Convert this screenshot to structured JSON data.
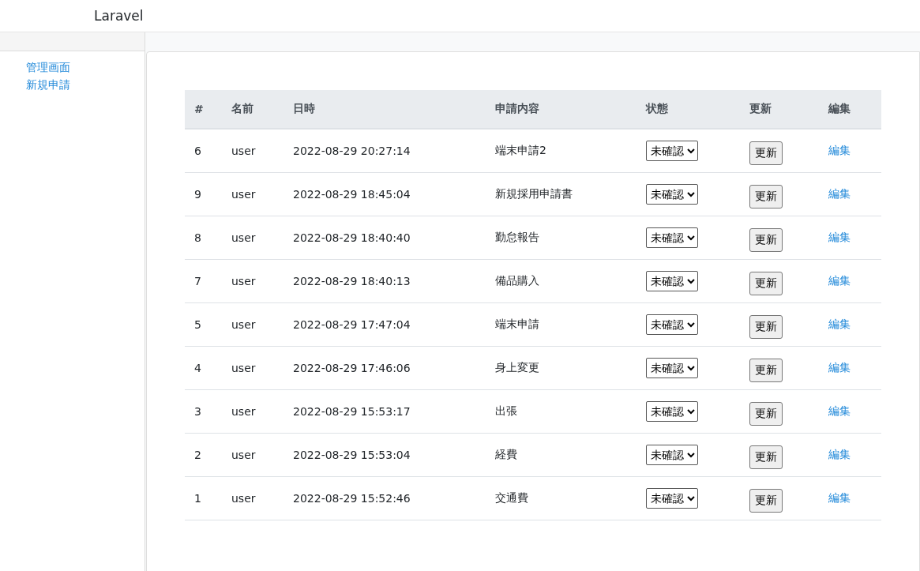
{
  "navbar": {
    "brand": "Laravel"
  },
  "sidebar": {
    "items": [
      {
        "label": "管理画面"
      },
      {
        "label": "新規申請"
      }
    ]
  },
  "table": {
    "columns": [
      "#",
      "名前",
      "日時",
      "申請内容",
      "状態",
      "更新",
      "編集"
    ],
    "rows": [
      {
        "id": "6",
        "name": "user",
        "datetime": "2022-08-29 20:27:14",
        "content": "端末申請2",
        "status": "未確認",
        "update": "更新",
        "edit": "編集"
      },
      {
        "id": "9",
        "name": "user",
        "datetime": "2022-08-29 18:45:04",
        "content": "新規採用申請書",
        "status": "未確認",
        "update": "更新",
        "edit": "編集"
      },
      {
        "id": "8",
        "name": "user",
        "datetime": "2022-08-29 18:40:40",
        "content": "勤怠報告",
        "status": "未確認",
        "update": "更新",
        "edit": "編集"
      },
      {
        "id": "7",
        "name": "user",
        "datetime": "2022-08-29 18:40:13",
        "content": "備品購入",
        "status": "未確認",
        "update": "更新",
        "edit": "編集"
      },
      {
        "id": "5",
        "name": "user",
        "datetime": "2022-08-29 17:47:04",
        "content": "端末申請",
        "status": "未確認",
        "update": "更新",
        "edit": "編集"
      },
      {
        "id": "4",
        "name": "user",
        "datetime": "2022-08-29 17:46:06",
        "content": "身上変更",
        "status": "未確認",
        "update": "更新",
        "edit": "編集"
      },
      {
        "id": "3",
        "name": "user",
        "datetime": "2022-08-29 15:53:17",
        "content": "出張",
        "status": "未確認",
        "update": "更新",
        "edit": "編集"
      },
      {
        "id": "2",
        "name": "user",
        "datetime": "2022-08-29 15:53:04",
        "content": "経費",
        "status": "未確認",
        "update": "更新",
        "edit": "編集"
      },
      {
        "id": "1",
        "name": "user",
        "datetime": "2022-08-29 15:52:46",
        "content": "交通費",
        "status": "未確認",
        "update": "更新",
        "edit": "編集"
      }
    ]
  }
}
